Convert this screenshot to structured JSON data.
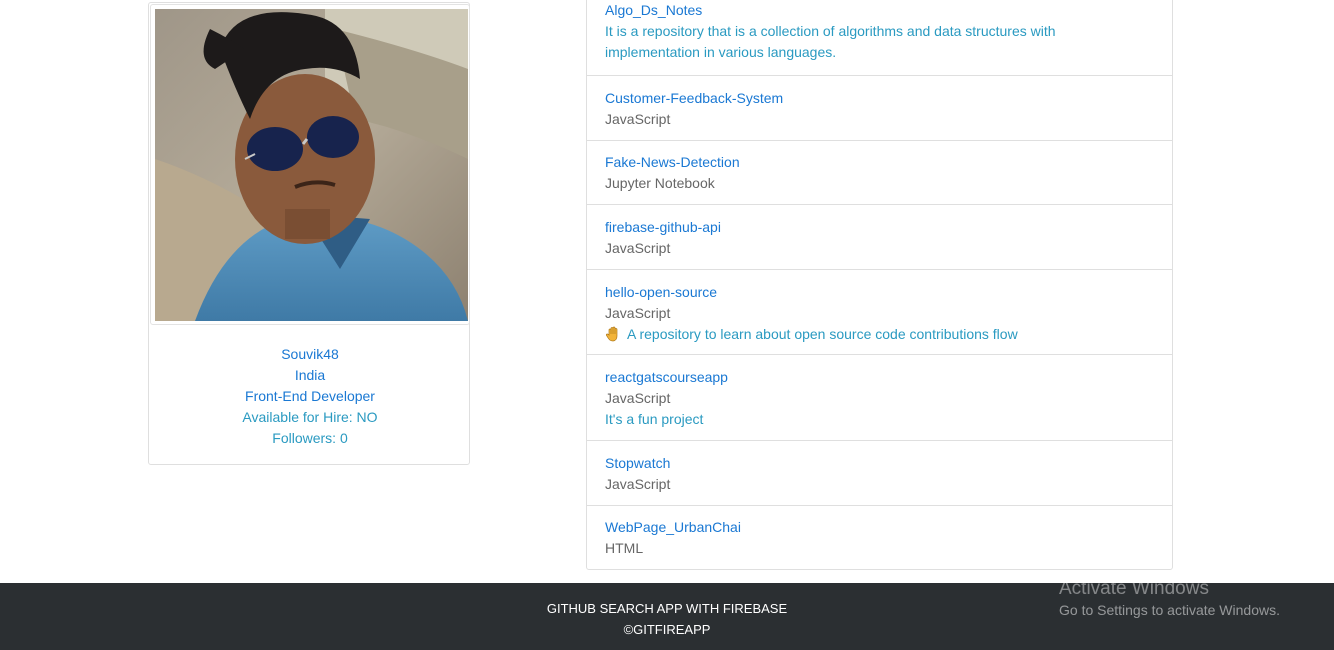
{
  "profile": {
    "avatar_alt": "Souvik48",
    "username": "Souvik48",
    "location": "India",
    "bio": "Front-End Developer",
    "hireable": "Available for Hire: NO",
    "followers": "Followers: 0"
  },
  "repos": [
    {
      "name": "Algo_Ds_Notes",
      "language": "",
      "description": "It is a repository that is a collection of algorithms and data structures with implementation in various languages.",
      "icon": ""
    },
    {
      "name": "Customer-Feedback-System",
      "language": "JavaScript",
      "description": "",
      "icon": ""
    },
    {
      "name": "Fake-News-Detection",
      "language": "Jupyter Notebook",
      "description": "",
      "icon": ""
    },
    {
      "name": "firebase-github-api",
      "language": "JavaScript",
      "description": "",
      "icon": ""
    },
    {
      "name": "hello-open-source",
      "language": "JavaScript",
      "description": "A repository to learn about open source code contributions flow",
      "icon": "raised-hand-icon"
    },
    {
      "name": "reactgatscourseapp",
      "language": "JavaScript",
      "description": "It's a fun project",
      "icon": ""
    },
    {
      "name": "Stopwatch",
      "language": "JavaScript",
      "description": "",
      "icon": ""
    },
    {
      "name": "WebPage_UrbanChai",
      "language": "HTML",
      "description": "",
      "icon": ""
    }
  ],
  "footer": {
    "title": "GITHUB SEARCH APP WITH FIREBASE",
    "copyright": "©GITFIREAPP"
  },
  "watermark": {
    "title": "Activate Windows",
    "subtitle": "Go to Settings to activate Windows."
  }
}
